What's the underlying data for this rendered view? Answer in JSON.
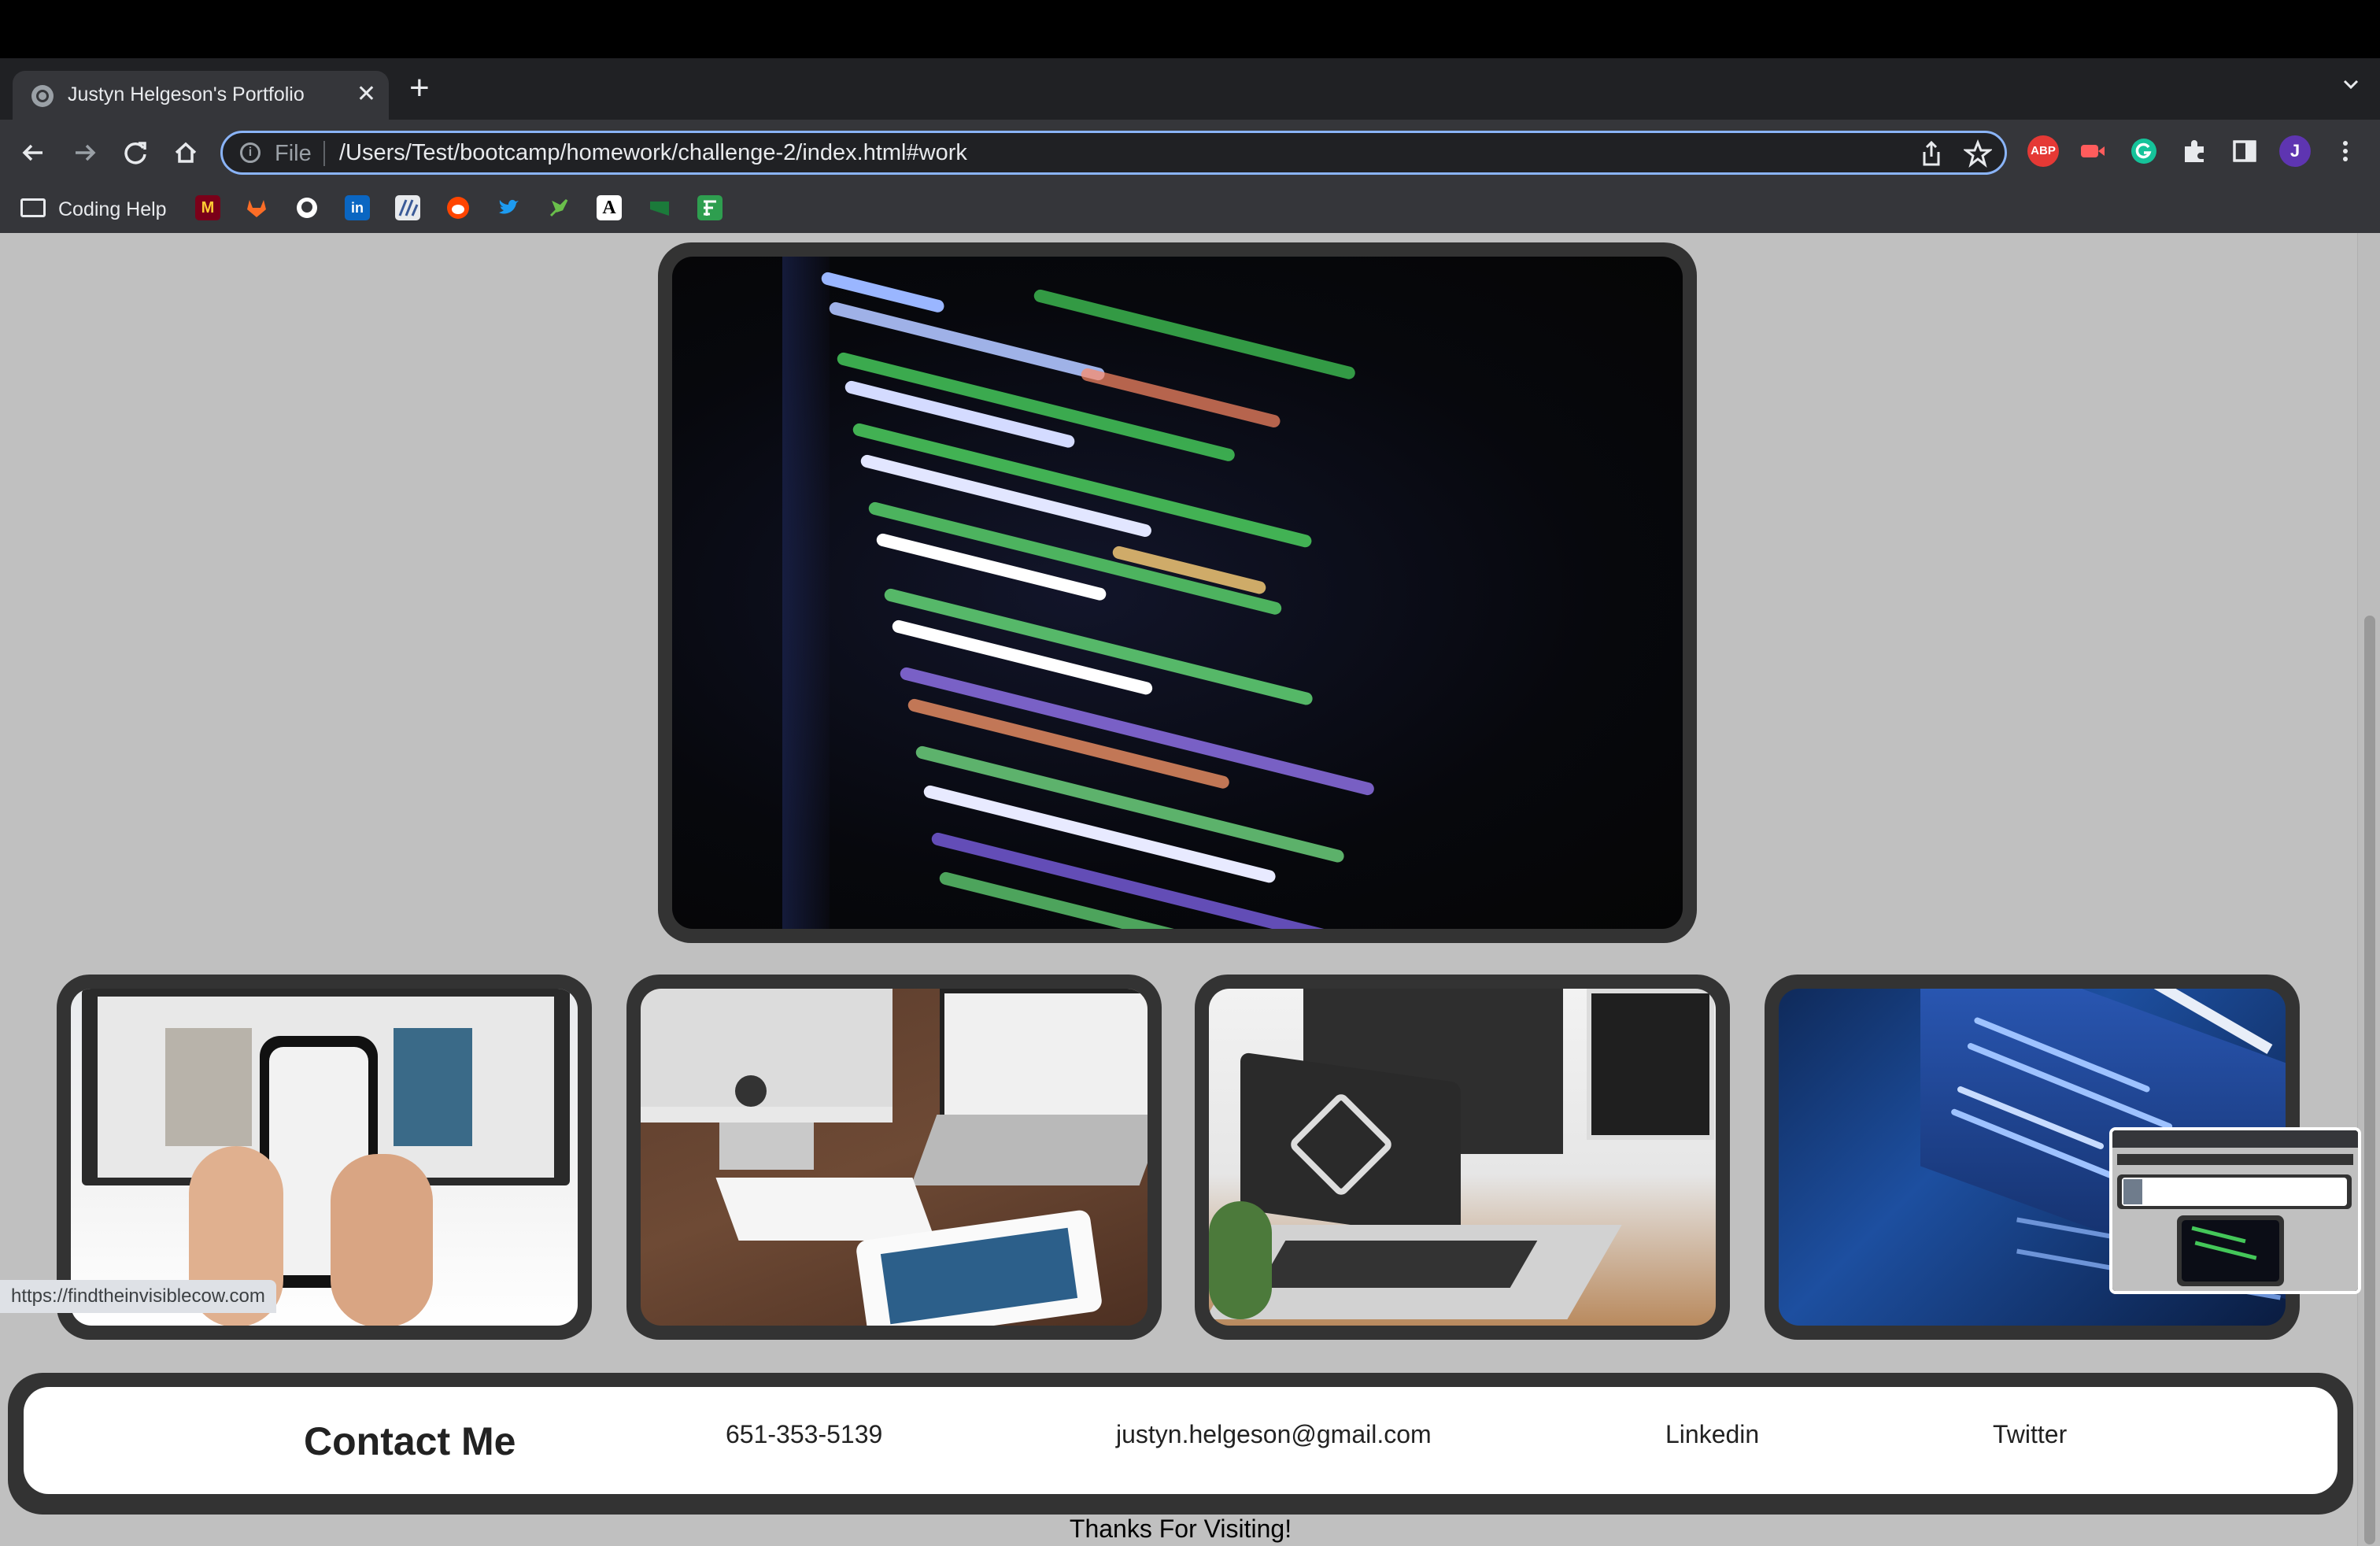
{
  "browser": {
    "tab_title": "Justyn Helgeson's Portfolio",
    "tab_close": "✕",
    "new_tab": "+",
    "scheme": "File",
    "url": "/Users/Test/bootcamp/homework/challenge-2/index.html#work",
    "profile_initial": "J",
    "abp_label": "ABP",
    "bookmark_folder": "Coding Help",
    "status_url": "https://findtheinvisiblecow.com"
  },
  "colors": {
    "page_bg": "#c0c0c0",
    "card_frame": "#333333",
    "omnibox_border": "#8ab4f8"
  },
  "contact": {
    "title": "Contact Me",
    "phone": "651-353-5139",
    "email": "justyn.helgeson@gmail.com",
    "linkedin": "Linkedin",
    "twitter": "Twitter"
  },
  "footer": {
    "thanks": "Thanks For Visiting!"
  }
}
